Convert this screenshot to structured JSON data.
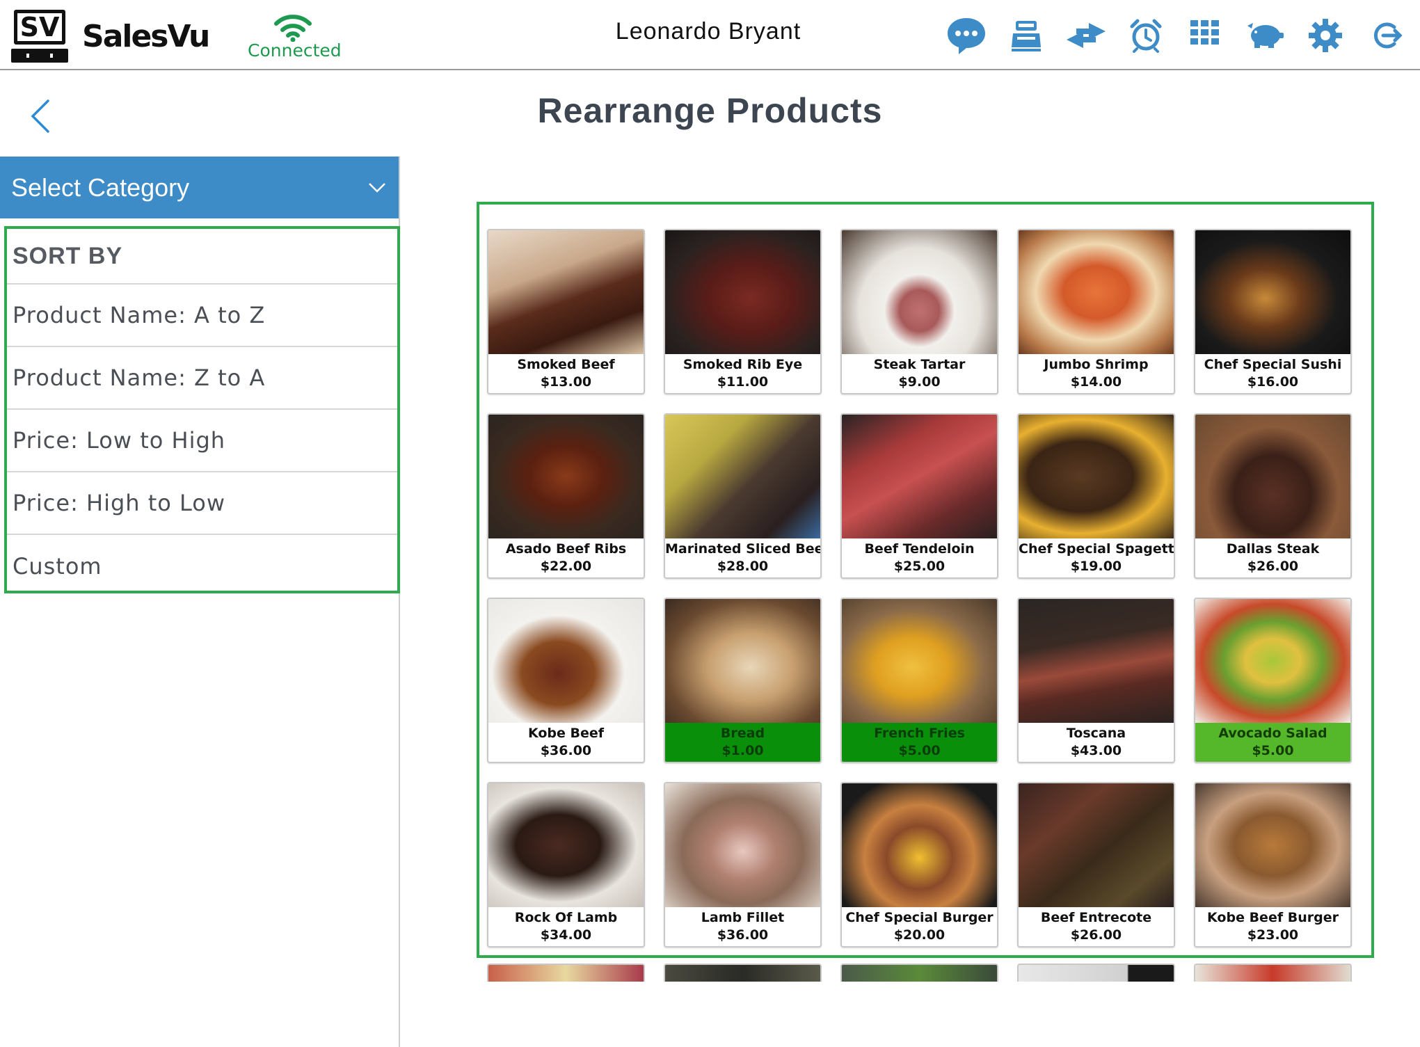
{
  "header": {
    "app_name": "SalesVu",
    "logo_mark": "SV",
    "connection_status": "Connected",
    "user_name": "Leonardo Bryant",
    "icons": [
      "chat-icon",
      "register-icon",
      "transfer-icon",
      "alarm-icon",
      "grid-icon",
      "piggy-bank-icon",
      "settings-icon",
      "logout-icon"
    ]
  },
  "page": {
    "title": "Rearrange Products",
    "back_icon": "chevron-left-icon"
  },
  "sidebar": {
    "category_select": "Select Category",
    "sort_heading": "SORT BY",
    "sort_options": [
      "Product Name: A to Z",
      "Product Name: Z to A",
      "Price: Low to High",
      "Price: High to Low",
      "Custom"
    ]
  },
  "products": [
    {
      "name": "Smoked Beef",
      "price": "$13.00"
    },
    {
      "name": "Smoked Rib Eye",
      "price": "$11.00"
    },
    {
      "name": "Steak Tartar",
      "price": "$9.00"
    },
    {
      "name": "Jumbo Shrimp",
      "price": "$14.00"
    },
    {
      "name": "Chef Special Sushi",
      "price": "$16.00"
    },
    {
      "name": "Asado Beef Ribs",
      "price": "$22.00"
    },
    {
      "name": "Marinated Sliced Beef",
      "price": "$28.00"
    },
    {
      "name": "Beef Tendeloin",
      "price": "$25.00"
    },
    {
      "name": "Chef Special Spagetti",
      "price": "$19.00"
    },
    {
      "name": "Dallas Steak",
      "price": "$26.00"
    },
    {
      "name": "Kobe Beef",
      "price": "$36.00"
    },
    {
      "name": "Bread",
      "price": "$1.00"
    },
    {
      "name": "French Fries",
      "price": "$5.00"
    },
    {
      "name": "Toscana",
      "price": "$43.00"
    },
    {
      "name": "Avocado Salad",
      "price": "$5.00"
    },
    {
      "name": "Rock Of Lamb",
      "price": "$34.00"
    },
    {
      "name": "Lamb Fillet",
      "price": "$36.00"
    },
    {
      "name": "Chef Special Burger",
      "price": "$20.00"
    },
    {
      "name": "Beef Entrecote",
      "price": "$26.00"
    },
    {
      "name": "Kobe Beef  Burger",
      "price": "$23.00"
    }
  ],
  "colors": {
    "accent_blue": "#3d8bc7",
    "selection_green": "#2eab4d",
    "highlight_dark_green": "#0a8f0a",
    "highlight_light_green": "#55b82a",
    "connected_green": "#1d9a4f"
  }
}
